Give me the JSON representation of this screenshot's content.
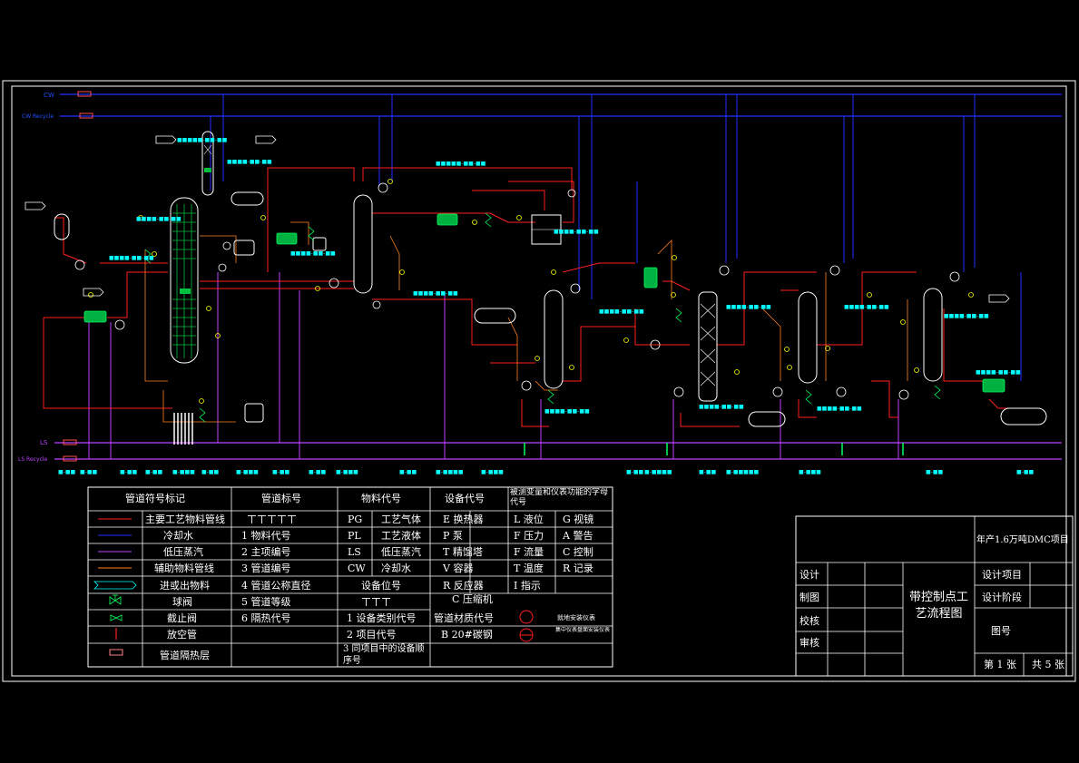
{
  "colors": {
    "background": "#000000",
    "frame": "#ffffff",
    "process": "#ff2020",
    "cooling_water": "#2030ff",
    "low_pressure_steam": "#c040ff",
    "auxiliary": "#ff8020",
    "equipment": "#ffffff",
    "exchanger": "#00c040",
    "instrument": "#ffff00",
    "valve": "#00ff60",
    "label": "#00ffff"
  },
  "headers": {
    "cw": "CW",
    "cw_recycle": "CW Recycle",
    "ls": "LS",
    "ls_recycle": "LS Recycle"
  },
  "legend": {
    "col1_title": "管道符号标记",
    "col2_title": "管道标号",
    "col3_title": "物料代号",
    "col4_title": "设备代号",
    "col5_title": "被测变量和仪表功能的字母代号",
    "symbols": [
      {
        "label": "主要工艺物料管线",
        "icon": "red-line"
      },
      {
        "label": "冷却水",
        "icon": "blue-line"
      },
      {
        "label": "低压蒸汽",
        "icon": "purple-line"
      },
      {
        "label": "辅助物料管线",
        "icon": "orange-line"
      },
      {
        "label": "进或出物料",
        "icon": "arrow-box"
      },
      {
        "label": "球阀",
        "icon": "ball-valve"
      },
      {
        "label": "截止阀",
        "icon": "globe-valve"
      },
      {
        "label": "放空管",
        "icon": "vent-pipe"
      },
      {
        "label": "管道隔热层",
        "icon": "insulation"
      }
    ],
    "pipe_code_sample": "ㄒㄒㄒㄒㄒ",
    "pipe_items": [
      "1 物料代号",
      "2 主项编号",
      "3 管道编号",
      "4 管道公称直径",
      "5 管道等级",
      "6 隔热代号"
    ],
    "materials": [
      {
        "code": "PG",
        "name": "工艺气体"
      },
      {
        "code": "PL",
        "name": "工艺液体"
      },
      {
        "code": "LS",
        "name": "低压蒸汽"
      },
      {
        "code": "CW",
        "name": "冷却水"
      }
    ],
    "equip_pos_title": "设备位号",
    "equip_pos_sample": "ㄒㄒㄒ",
    "equip_pos_items": [
      "1 设备类别代号",
      "2 项目代号",
      "3 同项目中的设备顺序号"
    ],
    "pipe_material_title": "管道材质代号",
    "pipe_material_value": "B 20#碳钢",
    "equipment_codes": [
      "E 换热器",
      "P 泵",
      "T 精馏塔",
      "V 容器",
      "R 反应器",
      "C 压缩机"
    ],
    "variable_codes": [
      "L 液位",
      "F 压力",
      "F 流量",
      "T 温度",
      "I 指示"
    ],
    "function_codes": [
      "G 视镜",
      "A 警告",
      "C 控制",
      "R 记录"
    ],
    "instrument_local": "就地安装仪表",
    "instrument_panel": "集中仪表盘面安装仪表"
  },
  "title_block": {
    "project": "年产1.6万吨DMC项目",
    "roles": [
      "设计",
      "制图",
      "校核",
      "审核"
    ],
    "drawing_title": "带控制点工艺流程图",
    "fields": [
      "设计项目",
      "设计阶段",
      "图号"
    ],
    "sheet": "第 1 张",
    "total": "共 5 张"
  }
}
